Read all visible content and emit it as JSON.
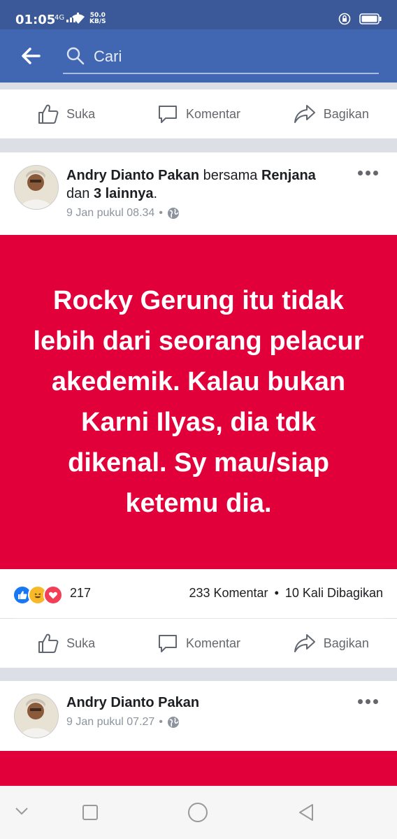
{
  "status_bar": {
    "time": "01:05",
    "network": "4G",
    "speed_value": "50.0",
    "speed_unit": "KB/S"
  },
  "search": {
    "placeholder": "Cari"
  },
  "actions": {
    "like": "Suka",
    "comment": "Komentar",
    "share": "Bagikan"
  },
  "post1": {
    "author": "Andry Dianto Pakan",
    "with_word": "bersama",
    "tagged": "Renjana",
    "and_word": "dan",
    "others": "3 lainnya",
    "dot": ".",
    "time": "9 Jan pukul 08.34",
    "separator": "•",
    "content": "Rocky Gerung itu tidak lebih dari seorang pelacur akedemik. Kalau bukan Karni Ilyas, dia tdk dikenal. Sy mau/siap ketemu dia.",
    "reaction_count": "217",
    "comments": "233 Komentar",
    "shares": "10 Kali Dibagikan",
    "content_bg": "#e2003a"
  },
  "post2": {
    "author": "Andry Dianto Pakan",
    "time": "9 Jan pukul 07.27",
    "separator": "•"
  },
  "colors": {
    "statusbar": "#3b5998",
    "appbar": "#4267b2",
    "post_red": "#e2003a"
  }
}
